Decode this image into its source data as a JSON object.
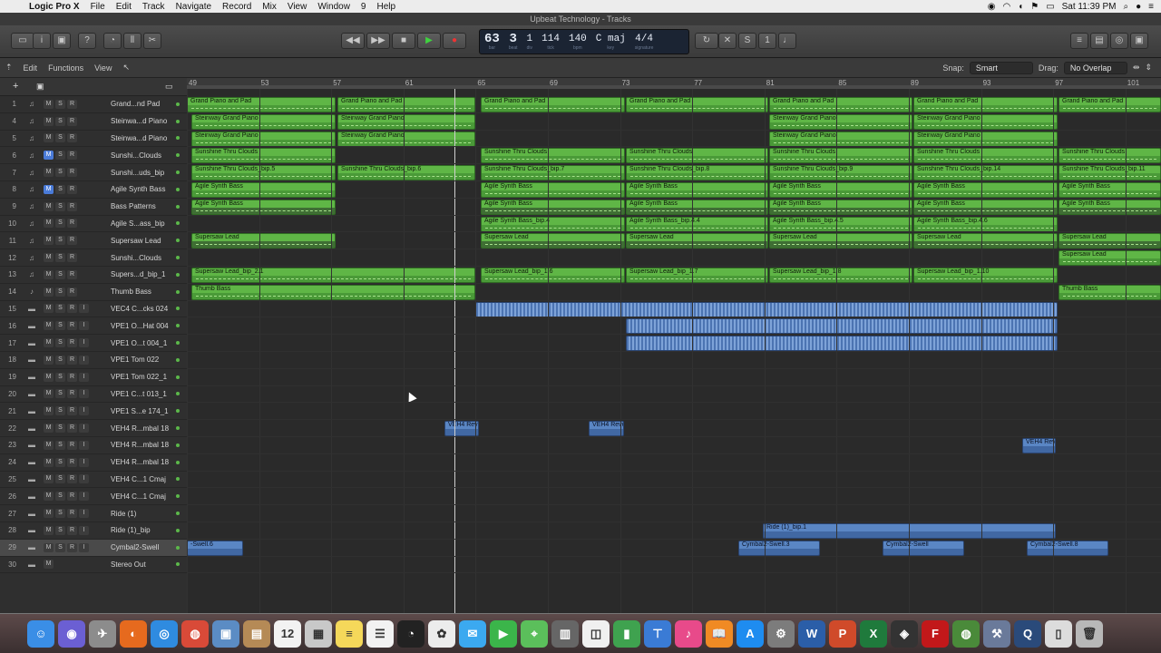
{
  "menubar": {
    "app": "Logic Pro X",
    "items": [
      "File",
      "Edit",
      "Track",
      "Navigate",
      "Record",
      "Mix",
      "View",
      "Window",
      "9",
      "Help"
    ],
    "clock": "Sat 11:39 PM"
  },
  "window": {
    "title": "Upbeat Technology - Tracks"
  },
  "lcd": {
    "bar": "63",
    "beat": "3",
    "div": "1",
    "tick": "114",
    "tempo": "140",
    "key": "C maj",
    "signature": "4/4",
    "bar_label": "bar",
    "beat_label": "beat",
    "div_label": "div",
    "tick_label": "tick",
    "tempo_label": "bpm",
    "key_label": "key",
    "sig_label": "signature"
  },
  "subbar": {
    "edit": "Edit",
    "functions": "Functions",
    "view": "View",
    "snap_label": "Snap:",
    "snap_value": "Smart",
    "drag_label": "Drag:",
    "drag_value": "No Overlap"
  },
  "ruler": {
    "ticks": [
      "49",
      "53",
      "57",
      "61",
      "65",
      "69",
      "73",
      "77",
      "81",
      "85",
      "89",
      "93",
      "97",
      "101"
    ]
  },
  "master_level": 0.85,
  "tracks": [
    {
      "num": "1",
      "name": "Grand...nd Pad",
      "m": "M",
      "s": "S",
      "r": "R",
      "input": "",
      "mute_on": false,
      "icon": "keyboard-icon"
    },
    {
      "num": "4",
      "name": "Steinwa...d Piano",
      "m": "M",
      "s": "S",
      "r": "R",
      "input": "",
      "mute_on": false,
      "icon": "keyboard-icon"
    },
    {
      "num": "5",
      "name": "Steinwa...d Piano",
      "m": "M",
      "s": "S",
      "r": "R",
      "input": "",
      "mute_on": false,
      "icon": "keyboard-icon"
    },
    {
      "num": "6",
      "name": "Sunshi...Clouds",
      "m": "M",
      "s": "S",
      "r": "R",
      "input": "",
      "mute_on": true,
      "icon": "keyboard-icon"
    },
    {
      "num": "7",
      "name": "Sunshi...uds_bip",
      "m": "M",
      "s": "S",
      "r": "R",
      "input": "",
      "mute_on": false,
      "icon": "keyboard-icon"
    },
    {
      "num": "8",
      "name": "Agile Synth Bass",
      "m": "M",
      "s": "S",
      "r": "R",
      "input": "",
      "mute_on": true,
      "icon": "keyboard-icon"
    },
    {
      "num": "9",
      "name": "Bass Patterns",
      "m": "M",
      "s": "S",
      "r": "R",
      "input": "",
      "mute_on": false,
      "icon": "keyboard-icon"
    },
    {
      "num": "10",
      "name": "Agile S...ass_bip",
      "m": "M",
      "s": "S",
      "r": "R",
      "input": "",
      "mute_on": false,
      "icon": "keyboard-icon"
    },
    {
      "num": "11",
      "name": "Supersaw Lead",
      "m": "M",
      "s": "S",
      "r": "R",
      "input": "",
      "mute_on": false,
      "icon": "keyboard-icon"
    },
    {
      "num": "12",
      "name": "Sunshi...Clouds",
      "m": "M",
      "s": "S",
      "r": "R",
      "input": "",
      "mute_on": false,
      "icon": "keyboard-icon"
    },
    {
      "num": "13",
      "name": "Supers...d_bip_1",
      "m": "M",
      "s": "S",
      "r": "R",
      "input": "",
      "mute_on": false,
      "icon": "keyboard-icon"
    },
    {
      "num": "14",
      "name": "Thumb Bass",
      "m": "M",
      "s": "S",
      "r": "R",
      "input": "",
      "mute_on": false,
      "icon": "guitar-icon"
    },
    {
      "num": "15",
      "name": "VEC4 C...cks 024",
      "m": "M",
      "s": "S",
      "r": "R",
      "input": "I",
      "mute_on": false,
      "icon": "waveform-icon"
    },
    {
      "num": "16",
      "name": "VPE1 O...Hat 004",
      "m": "M",
      "s": "S",
      "r": "R",
      "input": "I",
      "mute_on": false,
      "icon": "waveform-icon"
    },
    {
      "num": "17",
      "name": "VPE1 O...t 004_1",
      "m": "M",
      "s": "S",
      "r": "R",
      "input": "I",
      "mute_on": false,
      "icon": "waveform-icon"
    },
    {
      "num": "18",
      "name": "VPE1 Tom 022",
      "m": "M",
      "s": "S",
      "r": "R",
      "input": "I",
      "mute_on": false,
      "icon": "waveform-icon"
    },
    {
      "num": "19",
      "name": "VPE1 Tom 022_1",
      "m": "M",
      "s": "S",
      "r": "R",
      "input": "I",
      "mute_on": false,
      "icon": "waveform-icon"
    },
    {
      "num": "20",
      "name": "VPE1 C...t 013_1",
      "m": "M",
      "s": "S",
      "r": "R",
      "input": "I",
      "mute_on": false,
      "icon": "waveform-icon"
    },
    {
      "num": "21",
      "name": "VPE1 S...e 174_1",
      "m": "M",
      "s": "S",
      "r": "R",
      "input": "I",
      "mute_on": false,
      "icon": "waveform-icon"
    },
    {
      "num": "22",
      "name": "VEH4 R...mbal 18",
      "m": "M",
      "s": "S",
      "r": "R",
      "input": "I",
      "mute_on": false,
      "icon": "waveform-icon"
    },
    {
      "num": "23",
      "name": "VEH4 R...mbal 18",
      "m": "M",
      "s": "S",
      "r": "R",
      "input": "I",
      "mute_on": false,
      "icon": "waveform-icon"
    },
    {
      "num": "24",
      "name": "VEH4 R...mbal 18",
      "m": "M",
      "s": "S",
      "r": "R",
      "input": "I",
      "mute_on": false,
      "icon": "waveform-icon"
    },
    {
      "num": "25",
      "name": "VEH4 C...1 Cmaj",
      "m": "M",
      "s": "S",
      "r": "R",
      "input": "I",
      "mute_on": false,
      "icon": "waveform-icon"
    },
    {
      "num": "26",
      "name": "VEH4 C...1 Cmaj",
      "m": "M",
      "s": "S",
      "r": "R",
      "input": "I",
      "mute_on": false,
      "icon": "waveform-icon"
    },
    {
      "num": "27",
      "name": "Ride (1)",
      "m": "M",
      "s": "S",
      "r": "R",
      "input": "I",
      "mute_on": false,
      "icon": "waveform-icon"
    },
    {
      "num": "28",
      "name": "Ride (1)_bip",
      "m": "M",
      "s": "S",
      "r": "R",
      "input": "I",
      "mute_on": false,
      "icon": "waveform-icon"
    },
    {
      "num": "29",
      "name": "Cymbal2-Swell",
      "m": "M",
      "s": "S",
      "r": "R",
      "input": "I",
      "mute_on": false,
      "icon": "waveform-icon"
    },
    {
      "num": "30",
      "name": "Stereo Out",
      "m": "M",
      "s": "",
      "r": "",
      "input": "",
      "mute_on": false,
      "icon": "output-icon"
    }
  ],
  "regions": [
    {
      "lane": 0,
      "c": "g",
      "s": 0,
      "e": 164,
      "t": "Grand Piano and Pad"
    },
    {
      "lane": 0,
      "c": "g",
      "s": 166,
      "e": 318,
      "t": "Grand Piano and Pad"
    },
    {
      "lane": 0,
      "c": "g",
      "s": 324,
      "e": 483,
      "t": "Grand Piano and Pad"
    },
    {
      "lane": 0,
      "c": "g",
      "s": 484,
      "e": 641,
      "t": "Grand Piano and Pad"
    },
    {
      "lane": 0,
      "c": "g",
      "s": 642,
      "e": 800,
      "t": "Grand Piano and Pad"
    },
    {
      "lane": 0,
      "c": "g",
      "s": 801,
      "e": 960,
      "t": "Grand Piano and Pad"
    },
    {
      "lane": 0,
      "c": "g",
      "s": 961,
      "e": 1074,
      "t": "Grand Piano and Pad"
    },
    {
      "lane": 1,
      "c": "g",
      "s": 5,
      "e": 164,
      "t": "Steinway Grand Piano"
    },
    {
      "lane": 1,
      "c": "g",
      "s": 166,
      "e": 318,
      "t": "Steinway Grand Piano"
    },
    {
      "lane": 1,
      "c": "g",
      "s": 642,
      "e": 800,
      "t": "Steinway Grand Piano"
    },
    {
      "lane": 1,
      "c": "g",
      "s": 801,
      "e": 960,
      "t": "Steinway Grand Piano"
    },
    {
      "lane": 2,
      "c": "g",
      "s": 5,
      "e": 164,
      "t": "Steinway Grand Piano"
    },
    {
      "lane": 2,
      "c": "g",
      "s": 166,
      "e": 318,
      "t": "Steinway Grand Piano"
    },
    {
      "lane": 2,
      "c": "g",
      "s": 642,
      "e": 800,
      "t": "Steinway Grand Piano"
    },
    {
      "lane": 2,
      "c": "g",
      "s": 801,
      "e": 960,
      "t": "Steinway Grand Piano"
    },
    {
      "lane": 3,
      "c": "g",
      "s": 5,
      "e": 164,
      "t": "Sunshine Thru Clouds"
    },
    {
      "lane": 3,
      "c": "g",
      "s": 324,
      "e": 483,
      "t": "Sunshine Thru Clouds"
    },
    {
      "lane": 3,
      "c": "g",
      "s": 484,
      "e": 641,
      "t": "Sunshine Thru Clouds"
    },
    {
      "lane": 3,
      "c": "g",
      "s": 642,
      "e": 800,
      "t": "Sunshine Thru Clouds"
    },
    {
      "lane": 3,
      "c": "g",
      "s": 801,
      "e": 960,
      "t": "Sunshine Thru Clouds"
    },
    {
      "lane": 3,
      "c": "g",
      "s": 961,
      "e": 1074,
      "t": "Sunshine Thru Clouds"
    },
    {
      "lane": 4,
      "c": "g",
      "s": 5,
      "e": 164,
      "t": "Sunshine Thru Clouds_bip.5"
    },
    {
      "lane": 4,
      "c": "g",
      "s": 166,
      "e": 318,
      "t": "Sunshine Thru Clouds_bip.6"
    },
    {
      "lane": 4,
      "c": "g",
      "s": 324,
      "e": 483,
      "t": "Sunshine Thru Clouds_bip.7"
    },
    {
      "lane": 4,
      "c": "g",
      "s": 484,
      "e": 641,
      "t": "Sunshine Thru Clouds_bip.8"
    },
    {
      "lane": 4,
      "c": "g",
      "s": 642,
      "e": 800,
      "t": "Sunshine Thru Clouds_bip.9"
    },
    {
      "lane": 4,
      "c": "g",
      "s": 801,
      "e": 960,
      "t": "Sunshine Thru Clouds_bip.14"
    },
    {
      "lane": 4,
      "c": "g",
      "s": 961,
      "e": 1074,
      "t": "Sunshine Thru Clouds_bip.11"
    },
    {
      "lane": 5,
      "c": "g",
      "s": 5,
      "e": 164,
      "t": "Agile Synth Bass"
    },
    {
      "lane": 5,
      "c": "g",
      "s": 324,
      "e": 483,
      "t": "Agile Synth Bass"
    },
    {
      "lane": 5,
      "c": "g",
      "s": 484,
      "e": 641,
      "t": "Agile Synth Bass"
    },
    {
      "lane": 5,
      "c": "g",
      "s": 642,
      "e": 800,
      "t": "Agile Synth Bass"
    },
    {
      "lane": 5,
      "c": "g",
      "s": 801,
      "e": 960,
      "t": "Agile Synth Bass"
    },
    {
      "lane": 5,
      "c": "g",
      "s": 961,
      "e": 1074,
      "t": "Agile Synth Bass"
    },
    {
      "lane": 6,
      "c": "d",
      "s": 5,
      "e": 164,
      "t": "Agile Synth Bass"
    },
    {
      "lane": 6,
      "c": "d",
      "s": 324,
      "e": 483,
      "t": "Agile Synth Bass"
    },
    {
      "lane": 6,
      "c": "d",
      "s": 484,
      "e": 641,
      "t": "Agile Synth Bass"
    },
    {
      "lane": 6,
      "c": "d",
      "s": 642,
      "e": 800,
      "t": "Agile Synth Bass"
    },
    {
      "lane": 6,
      "c": "d",
      "s": 801,
      "e": 960,
      "t": "Agile Synth Bass"
    },
    {
      "lane": 6,
      "c": "d",
      "s": 961,
      "e": 1074,
      "t": "Agile Synth Bass"
    },
    {
      "lane": 7,
      "c": "g",
      "s": 324,
      "e": 483,
      "t": "Agile Synth Bass_bip.4"
    },
    {
      "lane": 7,
      "c": "g",
      "s": 484,
      "e": 641,
      "t": "Agile Synth Bass_bip.4.4"
    },
    {
      "lane": 7,
      "c": "g",
      "s": 642,
      "e": 800,
      "t": "Agile Synth Bass_bip.4.5"
    },
    {
      "lane": 7,
      "c": "g",
      "s": 801,
      "e": 960,
      "t": "Agile Synth Bass_bip.4.6"
    },
    {
      "lane": 8,
      "c": "d",
      "s": 5,
      "e": 164,
      "t": "Supersaw Lead"
    },
    {
      "lane": 8,
      "c": "d",
      "s": 324,
      "e": 483,
      "t": "Supersaw Lead"
    },
    {
      "lane": 8,
      "c": "d",
      "s": 484,
      "e": 641,
      "t": "Supersaw Lead"
    },
    {
      "lane": 8,
      "c": "d",
      "s": 642,
      "e": 800,
      "t": "Supersaw Lead"
    },
    {
      "lane": 8,
      "c": "d",
      "s": 801,
      "e": 960,
      "t": "Supersaw Lead"
    },
    {
      "lane": 8,
      "c": "d",
      "s": 961,
      "e": 1074,
      "t": "Supersaw Lead"
    },
    {
      "lane": 9,
      "c": "g",
      "s": 961,
      "e": 1074,
      "t": "Supersaw Lead"
    },
    {
      "lane": 10,
      "c": "g",
      "s": 5,
      "e": 318,
      "t": "Supersaw Lead_bip_2.1"
    },
    {
      "lane": 10,
      "c": "g",
      "s": 324,
      "e": 483,
      "t": "Supersaw Lead_bip_1.6"
    },
    {
      "lane": 10,
      "c": "g",
      "s": 484,
      "e": 641,
      "t": "Supersaw Lead_bip_1.7"
    },
    {
      "lane": 10,
      "c": "g",
      "s": 642,
      "e": 800,
      "t": "Supersaw Lead_bip_1.8"
    },
    {
      "lane": 10,
      "c": "g",
      "s": 801,
      "e": 960,
      "t": "Supersaw Lead_bip_1.10"
    },
    {
      "lane": 11,
      "c": "g",
      "s": 5,
      "e": 318,
      "t": "Thumb Bass"
    },
    {
      "lane": 11,
      "c": "g",
      "s": 961,
      "e": 1074,
      "t": "Thumb Bass"
    },
    {
      "lane": 12,
      "c": "s",
      "s": 318,
      "e": 960,
      "t": ""
    },
    {
      "lane": 13,
      "c": "s",
      "s": 484,
      "e": 960,
      "t": ""
    },
    {
      "lane": 14,
      "c": "s",
      "s": 484,
      "e": 960,
      "t": ""
    },
    {
      "lane": 19,
      "c": "b",
      "s": 284,
      "e": 322,
      "t": "VEH4 Reve"
    },
    {
      "lane": 19,
      "c": "b",
      "s": 443,
      "e": 482,
      "t": "VEH4 Reve"
    },
    {
      "lane": 20,
      "c": "b",
      "s": 921,
      "e": 958,
      "t": "VEH4 Reve"
    },
    {
      "lane": 25,
      "c": "b",
      "s": 635,
      "e": 958,
      "t": "Ride (1)_bip.1"
    },
    {
      "lane": 26,
      "c": "b",
      "s": 0,
      "e": 62,
      "t": "-Swell.6"
    },
    {
      "lane": 26,
      "c": "b",
      "s": 608,
      "e": 698,
      "t": "Cymbal2-Swell.3"
    },
    {
      "lane": 26,
      "c": "b",
      "s": 767,
      "e": 857,
      "t": "Cymbal2-Swell"
    },
    {
      "lane": 26,
      "c": "b",
      "s": 926,
      "e": 1016,
      "t": "Cymbal2-Swell.8"
    }
  ],
  "dock": [
    {
      "name": "finder-icon",
      "color": "#3a8ee6",
      "g": "☺"
    },
    {
      "name": "siri-icon",
      "color": "#6b5fd3",
      "g": "◉"
    },
    {
      "name": "launchpad-icon",
      "color": "#8c8c8c",
      "g": "✈"
    },
    {
      "name": "firefox-icon",
      "color": "#e66a1e",
      "g": "◐"
    },
    {
      "name": "safari-icon",
      "color": "#2f8be0",
      "g": "◎"
    },
    {
      "name": "chrome-icon",
      "color": "#d94a38",
      "g": "◍"
    },
    {
      "name": "preview-icon",
      "color": "#5b8cc4",
      "g": "▣"
    },
    {
      "name": "contacts-icon",
      "color": "#b58a56",
      "g": "▤"
    },
    {
      "name": "calendar-icon",
      "color": "#f2f2f2",
      "g": "12"
    },
    {
      "name": "photos-icon",
      "color": "#c8c8c8",
      "g": "▦"
    },
    {
      "name": "notes-icon",
      "color": "#f5d85a",
      "g": "≡"
    },
    {
      "name": "reminders-icon",
      "color": "#f2f2f2",
      "g": "☰"
    },
    {
      "name": "logic-icon",
      "color": "#222",
      "g": "◔"
    },
    {
      "name": "photos-app-icon",
      "color": "#ececec",
      "g": "✿"
    },
    {
      "name": "messages-icon",
      "color": "#3ba9f0",
      "g": "✉"
    },
    {
      "name": "facetime-icon",
      "color": "#3bb54a",
      "g": "▶"
    },
    {
      "name": "maps-icon",
      "color": "#5bbf5b",
      "g": "⌖"
    },
    {
      "name": "books-icon",
      "color": "#666",
      "g": "▥"
    },
    {
      "name": "keynote-icon",
      "color": "#f0f0f0",
      "g": "◫"
    },
    {
      "name": "numbers-icon",
      "color": "#3fa24f",
      "g": "▮"
    },
    {
      "name": "keynote-pres-icon",
      "color": "#3a7bd5",
      "g": "⊤"
    },
    {
      "name": "itunes-icon",
      "color": "#e84a8a",
      "g": "♪"
    },
    {
      "name": "ibooks-icon",
      "color": "#f08a24",
      "g": "📖"
    },
    {
      "name": "app-store-icon",
      "color": "#1e8cf0",
      "g": "A"
    },
    {
      "name": "system-prefs-icon",
      "color": "#7c7c7c",
      "g": "⚙"
    },
    {
      "name": "word-icon",
      "color": "#2b5ea8",
      "g": "W"
    },
    {
      "name": "powerpoint-icon",
      "color": "#d04a2a",
      "g": "P"
    },
    {
      "name": "excel-icon",
      "color": "#1f7a3c",
      "g": "X"
    },
    {
      "name": "activity-icon",
      "color": "#333",
      "g": "◈"
    },
    {
      "name": "filezilla-icon",
      "color": "#c2181a",
      "g": "F"
    },
    {
      "name": "network-icon",
      "color": "#4a8a3a",
      "g": "◍"
    },
    {
      "name": "utility-icon",
      "color": "#6a7a9a",
      "g": "⚒"
    },
    {
      "name": "quicktime-icon",
      "color": "#2a4a7a",
      "g": "Q"
    },
    {
      "name": "document-icon",
      "color": "#dcdcdc",
      "g": "▯"
    },
    {
      "name": "trash-icon",
      "color": "#b8b8b8",
      "g": "🗑"
    }
  ]
}
